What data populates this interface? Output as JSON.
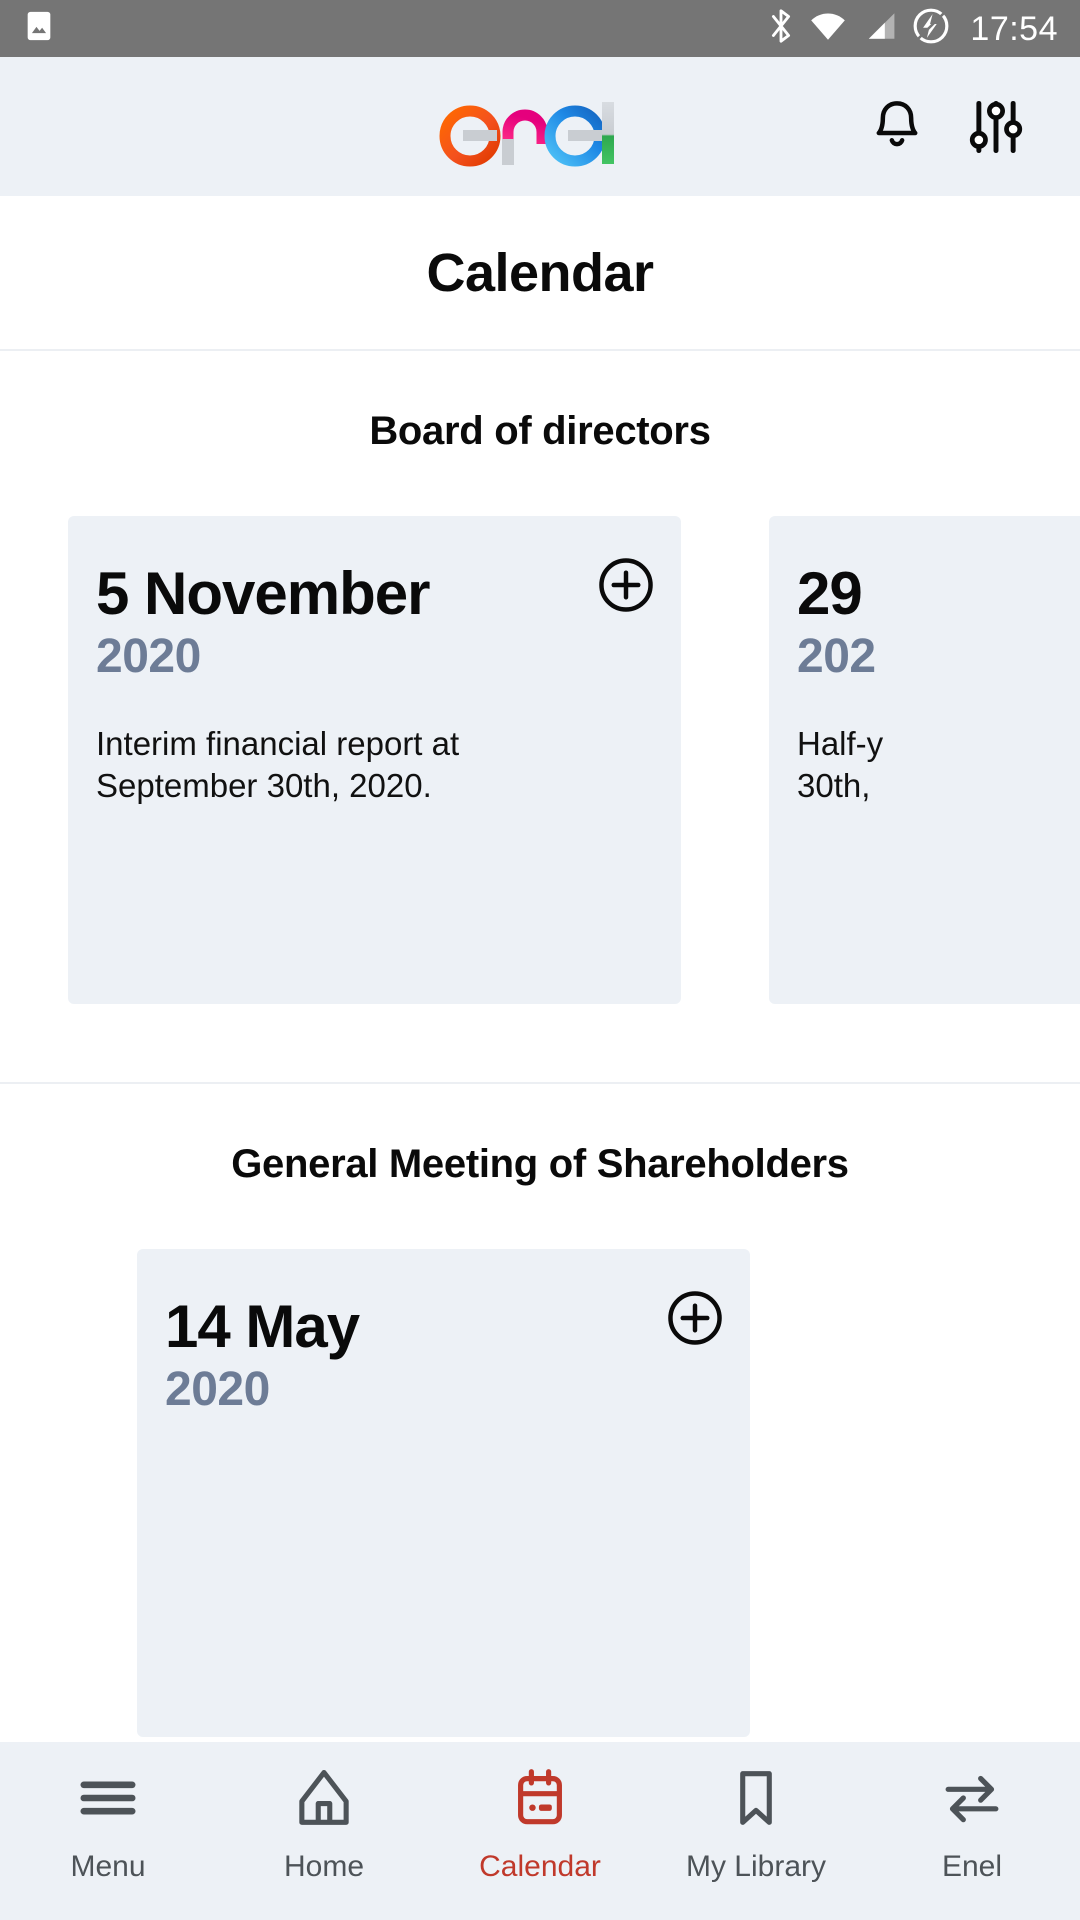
{
  "status_bar": {
    "time": "17:54",
    "left_icons": [
      "image-icon"
    ],
    "right_icons": [
      "bluetooth-icon",
      "wifi-icon",
      "cellular-signal-icon",
      "battery-charging-icon"
    ],
    "background_color": "#757575"
  },
  "app_header": {
    "logo_text": "enel",
    "logo_colors": {
      "e1": "#F4511E",
      "n": "#F5196F",
      "e2": "#1E88E5",
      "l": "#2EA84F",
      "crossbar": "#C9CDD2"
    },
    "background_color": "#EDF1F6",
    "actions": [
      {
        "name": "notifications-button",
        "icon": "bell-icon"
      },
      {
        "name": "settings-button",
        "icon": "sliders-icon"
      }
    ]
  },
  "page": {
    "title": "Calendar"
  },
  "sections": [
    {
      "title": "Board of directors",
      "cards": [
        {
          "day": "5 November",
          "year": "2020",
          "description": "Interim financial report at\nSeptember 30th, 2020.",
          "add_icon": "plus-circle-icon"
        },
        {
          "day": "29",
          "year": "202",
          "description": "Half-y\n30th,",
          "add_icon": "plus-circle-icon"
        }
      ]
    },
    {
      "title": "General Meeting of Shareholders",
      "cards": [
        {
          "day": "14 May",
          "year": "2020",
          "description": "",
          "add_icon": "plus-circle-icon"
        }
      ]
    }
  ],
  "bottom_nav": {
    "active_color": "#C0392B",
    "inactive_color": "#4D5358",
    "background_color": "#EDF1F6",
    "items": [
      {
        "label": "Menu",
        "icon": "hamburger-menu-icon",
        "active": false
      },
      {
        "label": "",
        "icon": "spacer",
        "active": false
      },
      {
        "label": "Home",
        "icon": "home-icon",
        "active": false
      },
      {
        "label": "Calendar",
        "icon": "calendar-icon",
        "active": true
      },
      {
        "label": "My Library",
        "icon": "bookmark-icon",
        "active": false
      },
      {
        "label": "Enel",
        "icon": "swap-arrows-icon",
        "active": false
      }
    ]
  }
}
